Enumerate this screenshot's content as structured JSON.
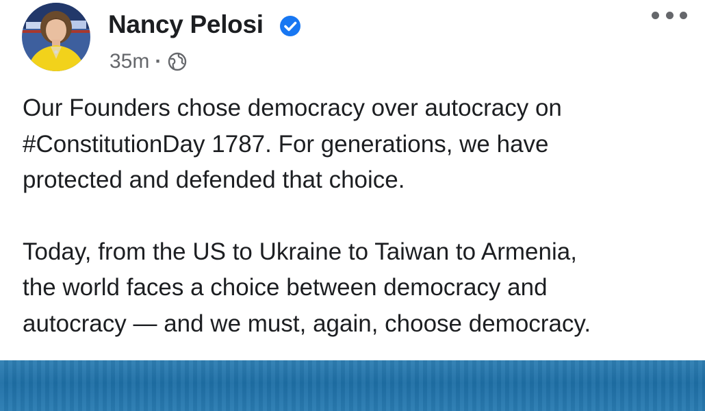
{
  "post": {
    "author": "Nancy Pelosi",
    "verified": true,
    "timestamp": "35m",
    "separator": "·",
    "audience_icon": "globe-icon",
    "more_icon": "more-options-icon",
    "paragraphs": [
      "Our Founders chose democracy over autocracy on\n#ConstitutionDay 1787. For generations, we have\nprotected and defended that choice.",
      "Today, from the US to Ukraine to Taiwan to Armenia,\nthe world faces a choice between democracy and\nautocracy — and we must, again, choose democracy."
    ]
  },
  "colors": {
    "verified_badge": "#1877f2",
    "text_primary": "#1c1e21",
    "text_secondary": "#65676b",
    "media_blue": "#1e6fa6",
    "avatar_jacket": "#f2d21b"
  }
}
